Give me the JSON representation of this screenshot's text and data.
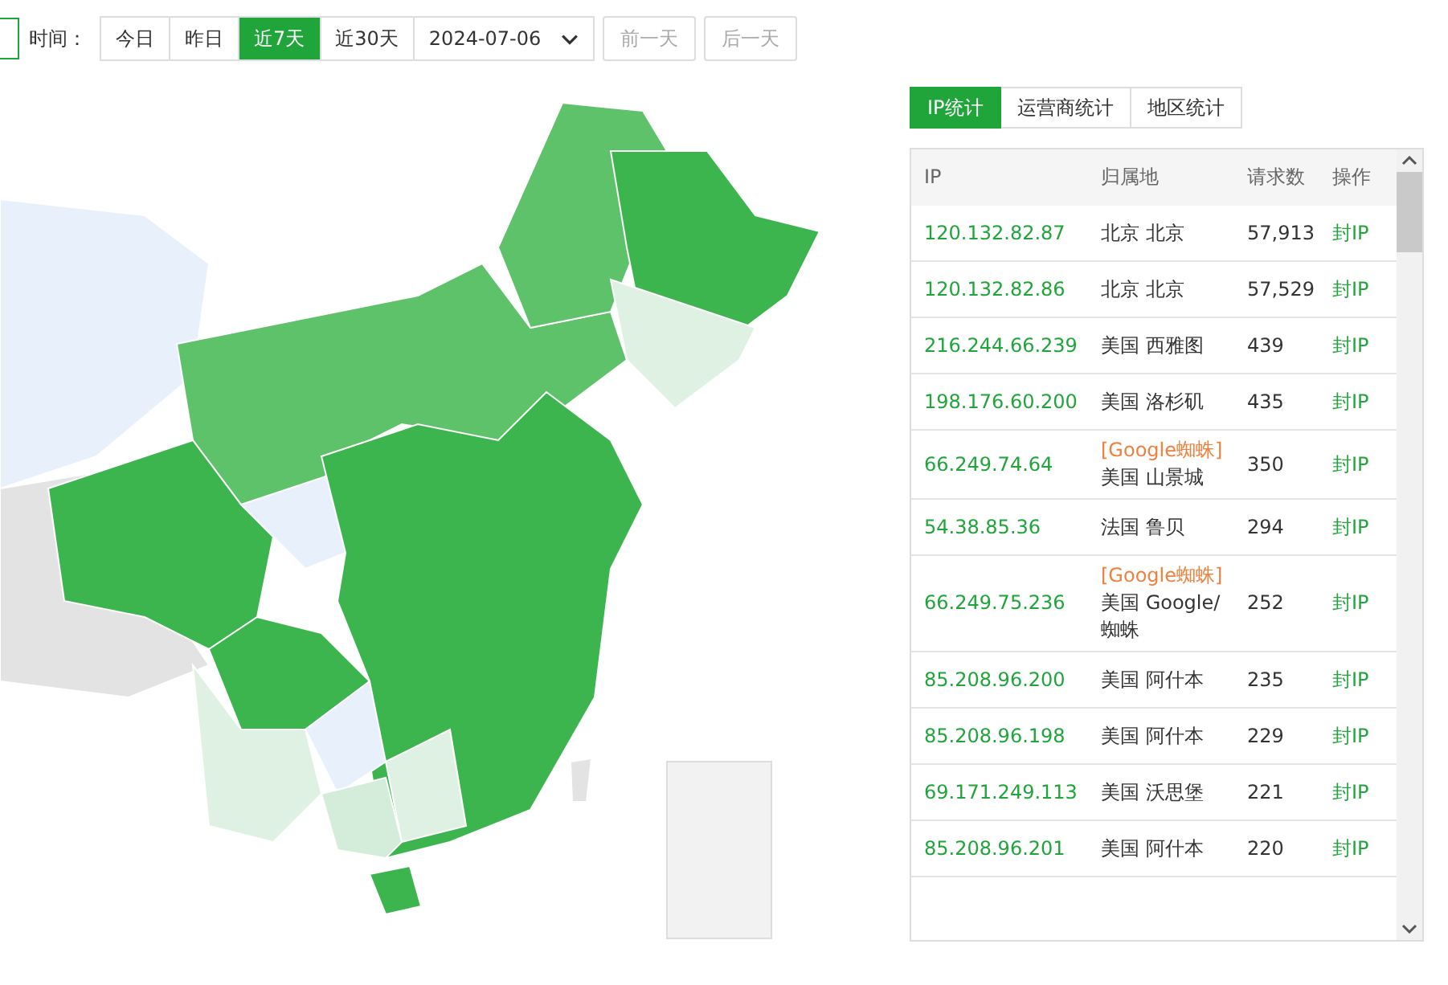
{
  "toolbar": {
    "label": "时间：",
    "ranges": [
      {
        "label": "今日",
        "selected": false
      },
      {
        "label": "昨日",
        "selected": false
      },
      {
        "label": "近7天",
        "selected": true
      },
      {
        "label": "近30天",
        "selected": false
      }
    ],
    "date": "2024-07-06",
    "nav": [
      {
        "label": "前一天",
        "disabled": true
      },
      {
        "label": "后一天",
        "disabled": true
      }
    ]
  },
  "tabs": [
    {
      "label": "IP统计",
      "selected": true
    },
    {
      "label": "运营商统计",
      "selected": false
    },
    {
      "label": "地区统计",
      "selected": false
    }
  ],
  "table": {
    "columns": [
      "IP",
      "归属地",
      "请求数",
      "操作"
    ],
    "rows": [
      {
        "ip": "120.132.82.87",
        "location": "北京 北京",
        "count": "57,913",
        "action": "封IP"
      },
      {
        "ip": "120.132.82.86",
        "location": "北京 北京",
        "count": "57,529",
        "action": "封IP"
      },
      {
        "ip": "216.244.66.239",
        "location": "美国 西雅图",
        "count": "439",
        "action": "封IP"
      },
      {
        "ip": "198.176.60.200",
        "location": "美国 洛杉矶",
        "count": "435",
        "action": "封IP"
      },
      {
        "ip": "66.249.74.64",
        "tag": "[Google蜘蛛]",
        "location": "美国 山景城",
        "count": "350",
        "action": "封IP"
      },
      {
        "ip": "54.38.85.36",
        "location": "法国 鲁贝",
        "count": "294",
        "action": "封IP"
      },
      {
        "ip": "66.249.75.236",
        "tag": "[Google蜘蛛]",
        "location": "美国 Google/蜘蛛",
        "count": "252",
        "action": "封IP"
      },
      {
        "ip": "85.208.96.200",
        "location": "美国 阿什本",
        "count": "235",
        "action": "封IP"
      },
      {
        "ip": "85.208.96.198",
        "location": "美国 阿什本",
        "count": "229",
        "action": "封IP"
      },
      {
        "ip": "69.171.249.113",
        "location": "美国 沃思堡",
        "count": "221",
        "action": "封IP"
      },
      {
        "ip": "85.208.96.201",
        "location": "美国 阿什本",
        "count": "220",
        "action": "封IP"
      }
    ]
  }
}
